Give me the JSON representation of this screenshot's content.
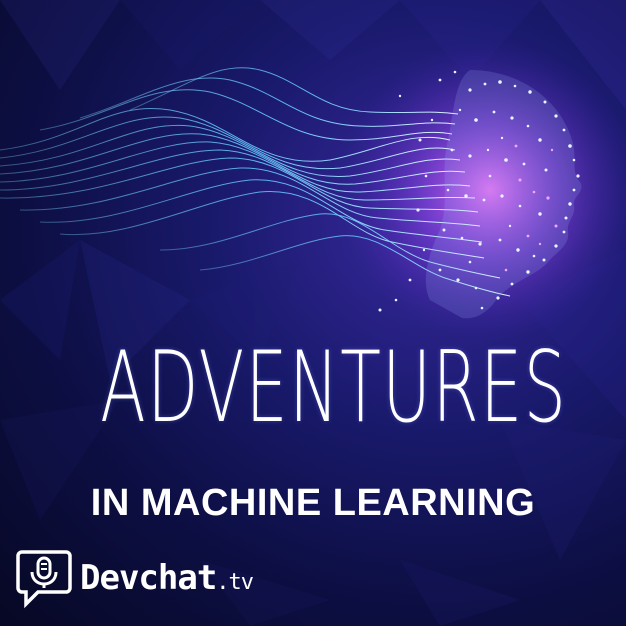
{
  "cover": {
    "title": "ADVENTURES",
    "subtitle": "IN MACHINE LEARNING"
  },
  "brand": {
    "name": "Devchat",
    "suffix": ".tv",
    "logo_icon": "microphone-speech-bubble-icon"
  },
  "colors": {
    "background_dark": "#0b0b3a",
    "background_mid": "#1a1a6e",
    "accent_cyan": "#5ad0ff",
    "accent_magenta": "#d060ff",
    "text": "#ffffff"
  }
}
